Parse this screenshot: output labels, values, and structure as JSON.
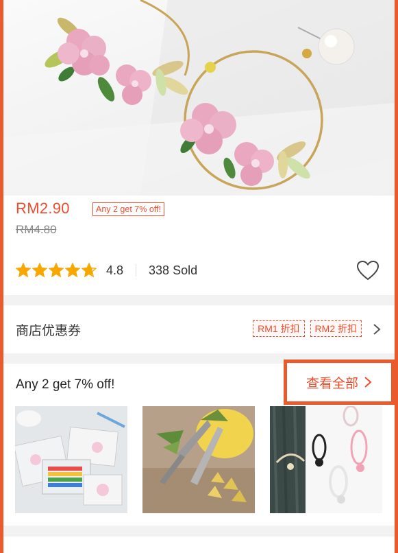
{
  "product": {
    "price": "RM2.90",
    "promo_badge": "Any 2 get 7% off!",
    "original_price": "RM4.80",
    "rating": "4.8",
    "rating_value": 4.8,
    "sold": "338 Sold"
  },
  "vouchers": {
    "label": "商店优惠券",
    "chips": [
      "RM1 折扣",
      "RM2 折扣"
    ]
  },
  "bundle": {
    "title": "Any 2 get 7% off!",
    "see_all": "查看全部"
  },
  "colors": {
    "accent": "#ee4d2d",
    "highlight_frame": "#ea5a2c",
    "star": "#f6a700"
  },
  "icons": {
    "favorite": "heart-icon",
    "chevron": "chevron-right-icon",
    "rating": "star-icon"
  }
}
